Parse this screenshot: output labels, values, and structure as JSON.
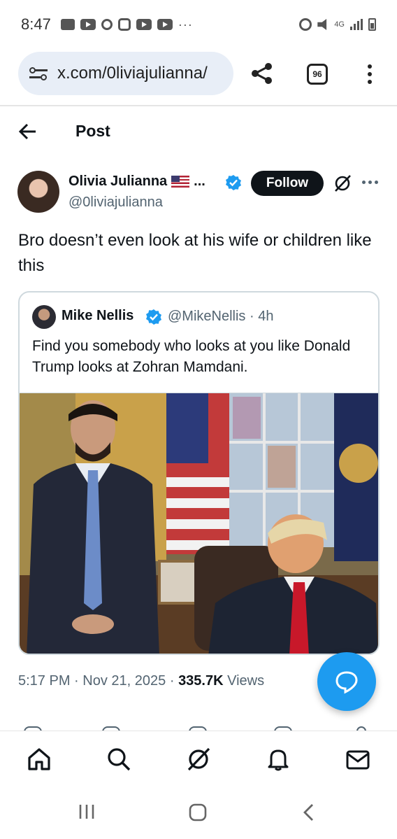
{
  "status_bar": {
    "time": "8:47",
    "more": "···",
    "network": "4G"
  },
  "browser": {
    "url": "x.com/0liviajulianna/",
    "tab_count": "96"
  },
  "header": {
    "title": "Post"
  },
  "post": {
    "author_name": "Olivia Julianna",
    "name_suffix": "...",
    "handle": "@0liviajulianna",
    "follow_label": "Follow",
    "text": "Bro doesn’t even look at his wife or children like this",
    "time": "5:17 PM",
    "date": "Nov 21, 2025",
    "views_count": "335.7K",
    "views_label": "Views",
    "separator": "·"
  },
  "quote": {
    "name": "Mike Nellis",
    "handle": "@MikeNellis",
    "age": "4h",
    "meta": "@MikeNellis · 4h",
    "text": "Find you somebody who looks at you like Donald Trump looks at Zohran Mamdani."
  },
  "colors": {
    "accent": "#1d9bf0",
    "text": "#0f1419",
    "secondary": "#536471",
    "url_bar": "#e8eef7"
  },
  "icons": {
    "back": "arrow-left-icon",
    "share": "share-icon",
    "tabs": "tab-switcher-icon",
    "menu": "kebab-menu-icon",
    "grok": "grok-icon",
    "compose": "chat-bubble-icon",
    "nav": [
      "home-icon",
      "search-icon",
      "grok-icon",
      "bell-icon",
      "mail-icon"
    ]
  }
}
